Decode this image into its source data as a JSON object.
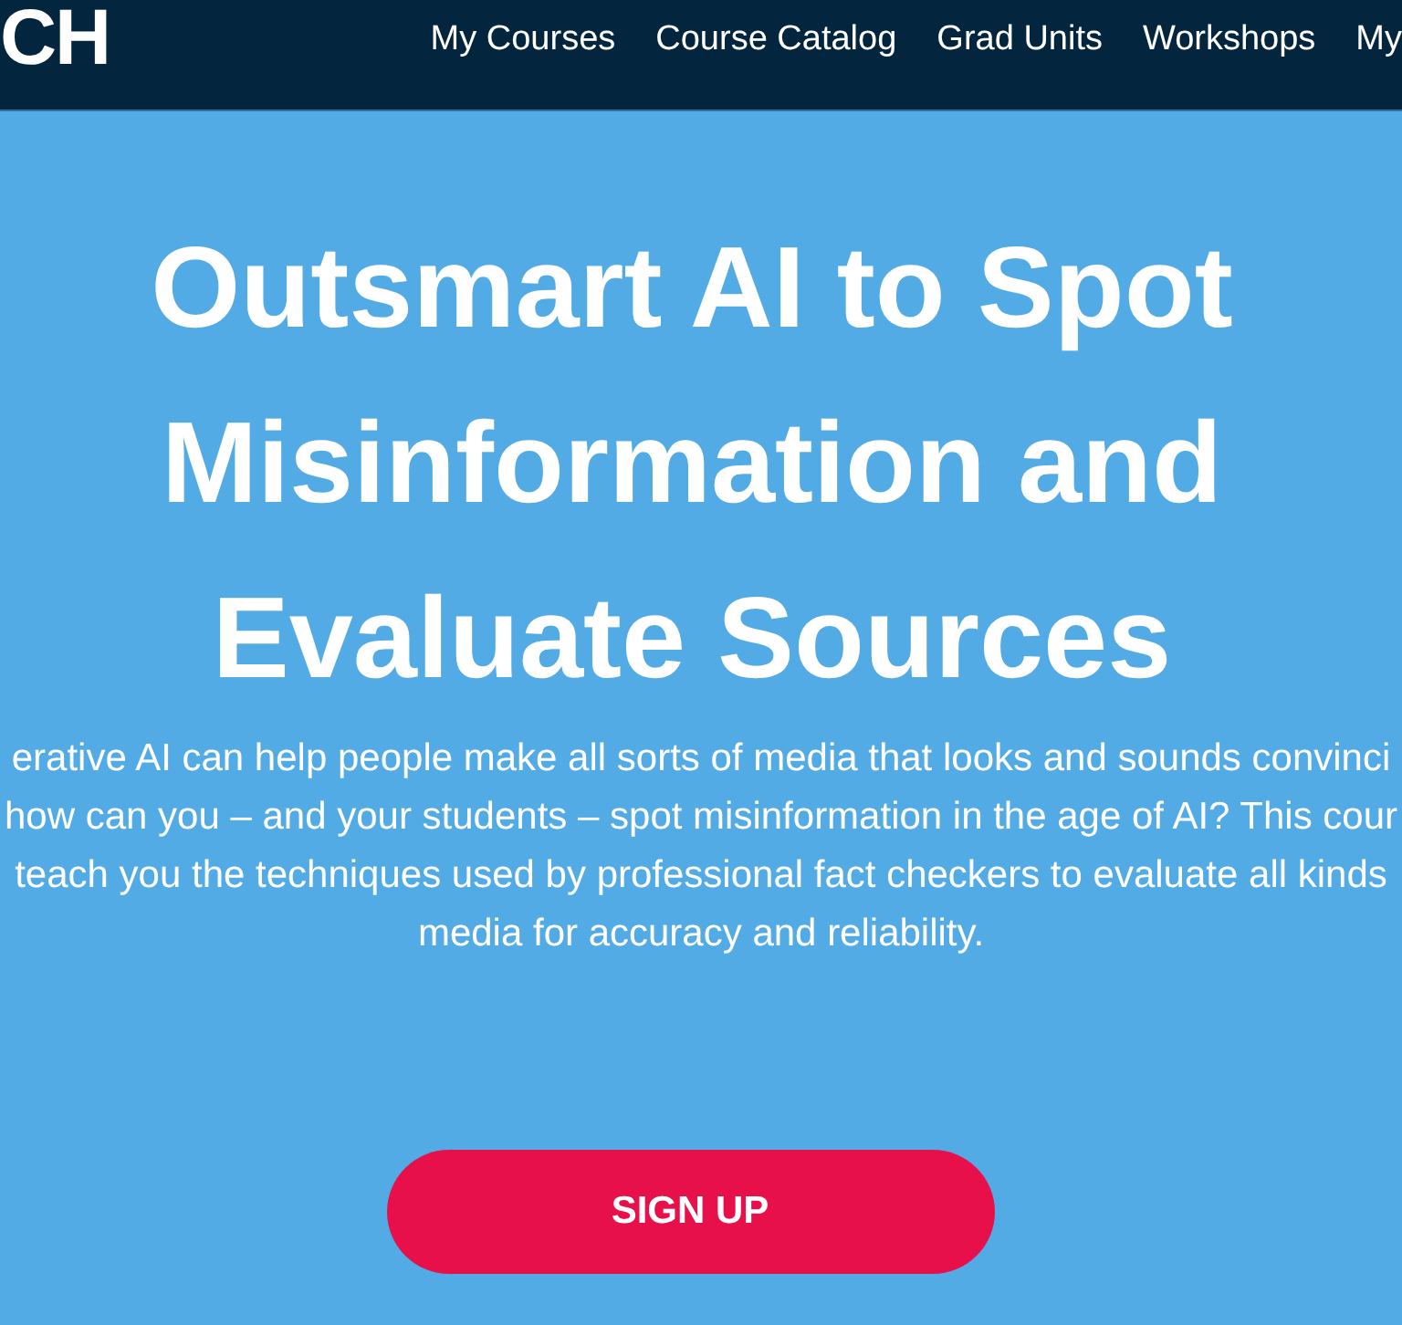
{
  "header": {
    "logo": "CH",
    "nav": [
      "My Courses",
      "Course Catalog",
      "Grad Units",
      "Workshops",
      "My"
    ]
  },
  "hero": {
    "title": "Outsmart AI to Spot Misinformation and Evaluate Sources",
    "description_lines": [
      "erative AI can help people make all sorts of media that looks and sounds convinci",
      "how can you – and your students – spot misinformation in the age of AI? This cour",
      "teach you the techniques used by professional fact checkers to evaluate all kinds",
      "media for accuracy and reliability."
    ],
    "button": "SIGN UP"
  }
}
